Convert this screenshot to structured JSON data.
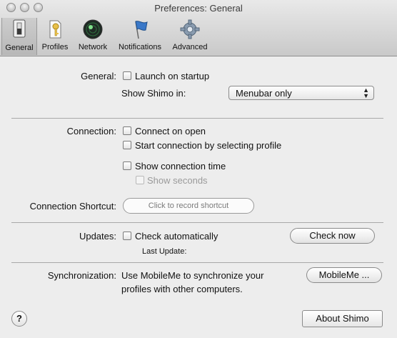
{
  "window": {
    "title": "Preferences: General"
  },
  "toolbar": {
    "items": [
      {
        "label": "General",
        "icon": "switch-icon",
        "selected": true
      },
      {
        "label": "Profiles",
        "icon": "key-document-icon",
        "selected": false
      },
      {
        "label": "Network",
        "icon": "radar-icon",
        "selected": false
      },
      {
        "label": "Notifications",
        "icon": "flag-icon",
        "selected": false
      },
      {
        "label": "Advanced",
        "icon": "gear-icon",
        "selected": false
      }
    ]
  },
  "general": {
    "label": "General:",
    "launch_on_startup": {
      "label": "Launch on startup",
      "checked": false
    },
    "show_in_label": "Show Shimo in:",
    "show_in_value": "Menubar only"
  },
  "connection": {
    "label": "Connection:",
    "connect_on_open": {
      "label": "Connect on open",
      "checked": false
    },
    "start_by_profile": {
      "label": "Start connection by selecting profile",
      "checked": false
    },
    "show_time": {
      "label": "Show connection time",
      "checked": false
    },
    "show_seconds": {
      "label": "Show seconds",
      "checked": false,
      "disabled": true
    },
    "shortcut_label": "Connection Shortcut:",
    "shortcut_placeholder": "Click to record shortcut"
  },
  "updates": {
    "label": "Updates:",
    "check_auto": {
      "label": "Check automatically",
      "checked": false
    },
    "check_now": "Check now",
    "last_update_label": "Last Update:"
  },
  "sync": {
    "label": "Synchronization:",
    "line1": "Use MobileMe to synchronize your",
    "line2": "profiles with other computers.",
    "button": "MobileMe ..."
  },
  "footer": {
    "help": "?",
    "about": "About Shimo"
  }
}
